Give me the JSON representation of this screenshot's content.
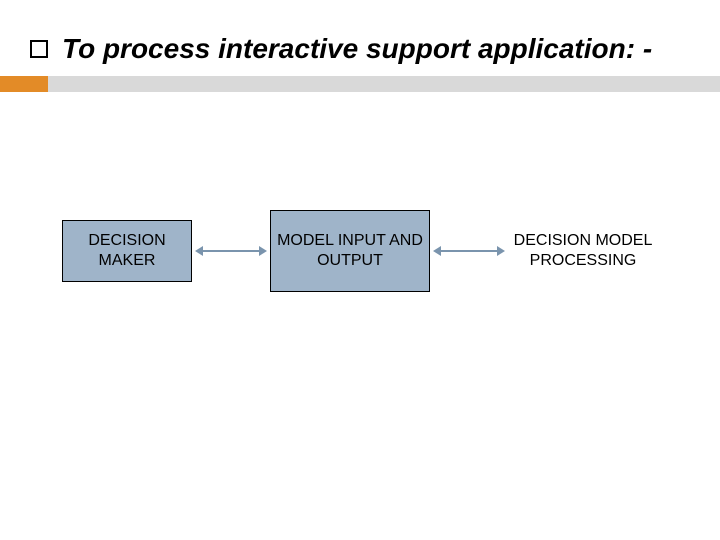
{
  "heading": {
    "text": "To process interactive support application: -"
  },
  "colors": {
    "accent_orange": "#e38b27",
    "accent_gray": "#d9d9d9",
    "node_fill": "#9fb4c9",
    "connector": "#7a94ad"
  },
  "nodes": {
    "left": "DECISION MAKER",
    "middle": "MODEL INPUT AND OUTPUT",
    "right": "DECISION MODEL PROCESSING"
  }
}
